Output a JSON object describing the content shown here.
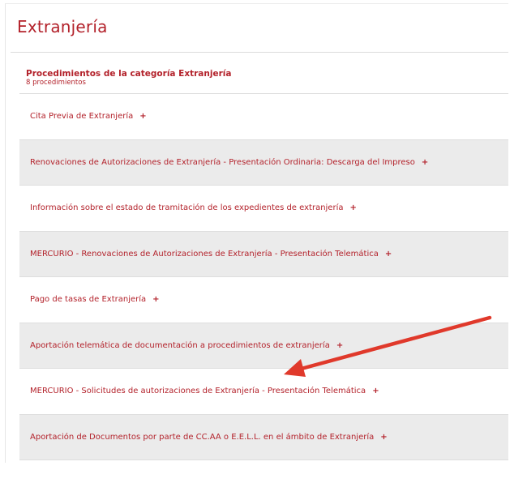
{
  "page": {
    "title": "Extranjería"
  },
  "category": {
    "title": "Procedimientos de la categoría Extranjería",
    "count_label": "8 procedimientos"
  },
  "procedures": [
    {
      "label": "Cita Previa de Extranjería",
      "expand_icon": "+"
    },
    {
      "label": "Renovaciones de Autorizaciones de Extranjería - Presentación Ordinaria: Descarga del Impreso",
      "expand_icon": "+"
    },
    {
      "label": "Información sobre el estado de tramitación de los expedientes de extranjería",
      "expand_icon": "+"
    },
    {
      "label": "MERCURIO - Renovaciones de Autorizaciones de Extranjería - Presentación Telemática",
      "expand_icon": "+"
    },
    {
      "label": "Pago de tasas de Extranjería",
      "expand_icon": "+"
    },
    {
      "label": "Aportación telemática de documentación a procedimientos de extranjería",
      "expand_icon": "+"
    },
    {
      "label": "MERCURIO - Solicitudes de autorizaciones de Extranjería - Presentación Telemática",
      "expand_icon": "+"
    },
    {
      "label": "Aportación de Documentos por parte de CC.AA o E.E.L.L. en el ámbito de Extranjería",
      "expand_icon": "+"
    }
  ],
  "colors": {
    "accent": "#b3222b",
    "row_shade": "#ebebeb",
    "annotation_arrow": "#e0392b"
  },
  "annotation": {
    "icon": "red-arrow-icon",
    "points_to_item": 6
  }
}
